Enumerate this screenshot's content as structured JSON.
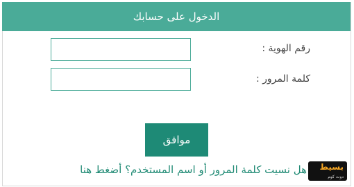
{
  "login": {
    "title": "الدخول على حسابك",
    "id_label": "رقم الهوية :",
    "password_label": "كلمة المرور :",
    "id_value": "",
    "password_value": "",
    "submit_label": "موافق",
    "forgot_link": "هل نسيت كلمة المرور أو اسم المستخدم؟ أضغط هنا"
  },
  "watermark": {
    "main": "بسيط",
    "sub": "دوت كوم"
  },
  "colors": {
    "header": "#4aab98",
    "button": "#1e8a76",
    "link": "#1f8a74",
    "field_border": "#4aab98"
  }
}
